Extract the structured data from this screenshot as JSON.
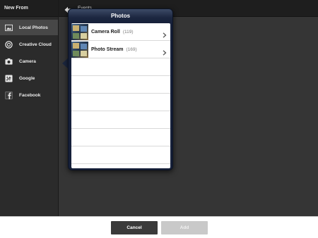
{
  "sidebar": {
    "title": "New From",
    "items": [
      {
        "label": "Local Photos",
        "icon": "image-icon",
        "active": true
      },
      {
        "label": "Creative Cloud",
        "icon": "creative-cloud-icon",
        "active": false
      },
      {
        "label": "Camera",
        "icon": "camera-icon",
        "active": false
      },
      {
        "label": "Google",
        "icon": "google-icon",
        "active": false
      },
      {
        "label": "Facebook",
        "icon": "facebook-icon",
        "active": false
      }
    ]
  },
  "topbar": {
    "back_icon": "back-arrow-icon",
    "label": "Events"
  },
  "popover": {
    "title": "Photos",
    "rows": [
      {
        "label": "Camera Roll",
        "count": "(119)"
      },
      {
        "label": "Photo Stream",
        "count": "(169)"
      }
    ]
  },
  "footer": {
    "cancel_label": "Cancel",
    "add_label": "Add"
  },
  "colors": {
    "sidebar_bg": "#2b2b2b",
    "active_item_bg": "#474747",
    "popover_header": "#1c2740",
    "cancel_button": "#3a3a3a",
    "add_button_disabled": "#c9c9c9"
  }
}
